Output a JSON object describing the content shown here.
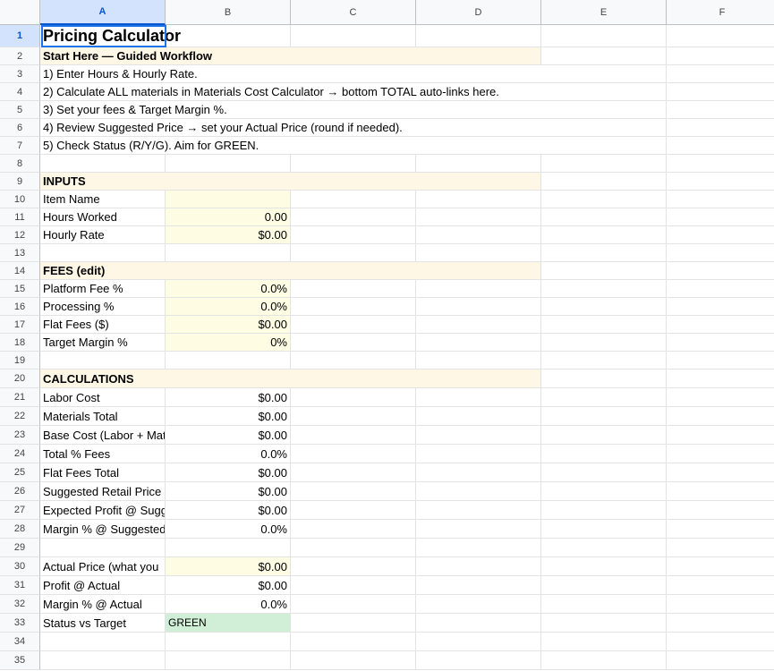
{
  "sheet": {
    "columns": [
      "A",
      "B",
      "C",
      "D",
      "E",
      "F"
    ],
    "selected_cell": "A1",
    "rows": [
      {
        "n": "1",
        "a": "Pricing Calculator",
        "b": "",
        "style": "title"
      },
      {
        "n": "2",
        "a": "Start Here — Guided Workflow",
        "b": "",
        "style": "section"
      },
      {
        "n": "3",
        "a": "1) Enter Hours & Hourly Rate.",
        "b": "",
        "style": "note"
      },
      {
        "n": "4",
        "a": "2) Calculate ALL materials in Materials Cost Calculator → bottom TOTAL auto-links here.",
        "b": "",
        "style": "note"
      },
      {
        "n": "5",
        "a": "3) Set your fees & Target Margin %.",
        "b": "",
        "style": "note"
      },
      {
        "n": "6",
        "a": "4) Review Suggested Price → set your Actual Price (round if needed).",
        "b": "",
        "style": "note"
      },
      {
        "n": "7",
        "a": "5) Check Status (R/Y/G). Aim for GREEN.",
        "b": "",
        "style": "note"
      },
      {
        "n": "8",
        "a": "",
        "b": "",
        "style": "blank"
      },
      {
        "n": "9",
        "a": "INPUTS",
        "b": "",
        "style": "section"
      },
      {
        "n": "10",
        "a": "Item Name",
        "b": "",
        "style": "input"
      },
      {
        "n": "11",
        "a": "Hours Worked",
        "b": "0.00",
        "style": "input"
      },
      {
        "n": "12",
        "a": "Hourly Rate",
        "b": "$0.00",
        "style": "input"
      },
      {
        "n": "13",
        "a": "",
        "b": "",
        "style": "blank"
      },
      {
        "n": "14",
        "a": "FEES (edit)",
        "b": "",
        "style": "section"
      },
      {
        "n": "15",
        "a": "Platform Fee %",
        "b": "0.0%",
        "style": "input"
      },
      {
        "n": "16",
        "a": "Processing %",
        "b": "0.0%",
        "style": "input"
      },
      {
        "n": "17",
        "a": "Flat Fees ($)",
        "b": "$0.00",
        "style": "input"
      },
      {
        "n": "18",
        "a": "Target Margin %",
        "b": "0%",
        "style": "input"
      },
      {
        "n": "19",
        "a": "",
        "b": "",
        "style": "blank"
      },
      {
        "n": "20",
        "a": "CALCULATIONS",
        "b": "",
        "style": "section"
      },
      {
        "n": "21",
        "a": "Labor Cost",
        "b": "$0.00",
        "style": "calc"
      },
      {
        "n": "22",
        "a": "Materials Total",
        "b": "$0.00",
        "style": "calc"
      },
      {
        "n": "23",
        "a": "Base Cost (Labor + Mat",
        "b": "$0.00",
        "style": "calc"
      },
      {
        "n": "24",
        "a": "Total % Fees",
        "b": "0.0%",
        "style": "calc"
      },
      {
        "n": "25",
        "a": "Flat Fees Total",
        "b": "$0.00",
        "style": "calc"
      },
      {
        "n": "26",
        "a": "Suggested Retail Price",
        "b": "$0.00",
        "style": "calc"
      },
      {
        "n": "27",
        "a": "Expected Profit @ Sugg",
        "b": "$0.00",
        "style": "calc"
      },
      {
        "n": "28",
        "a": "Margin % @ Suggested",
        "b": "0.0%",
        "style": "calc"
      },
      {
        "n": "29",
        "a": "",
        "b": "",
        "style": "blank"
      },
      {
        "n": "30",
        "a": "Actual Price (what you",
        "b": "$0.00",
        "style": "input"
      },
      {
        "n": "31",
        "a": "Profit @ Actual",
        "b": "$0.00",
        "style": "calc"
      },
      {
        "n": "32",
        "a": "Margin % @ Actual",
        "b": "0.0%",
        "style": "calc"
      },
      {
        "n": "33",
        "a": "Status vs Target",
        "b": "GREEN",
        "style": "status"
      },
      {
        "n": "34",
        "a": "",
        "b": "",
        "style": "blank"
      },
      {
        "n": "35",
        "a": "",
        "b": "",
        "style": "blank"
      }
    ]
  },
  "colors": {
    "section_bg": "#fef7e6",
    "input_bg": "#fefce3",
    "status_green_bg": "#d1efd6",
    "selection": "#1a73e8"
  }
}
